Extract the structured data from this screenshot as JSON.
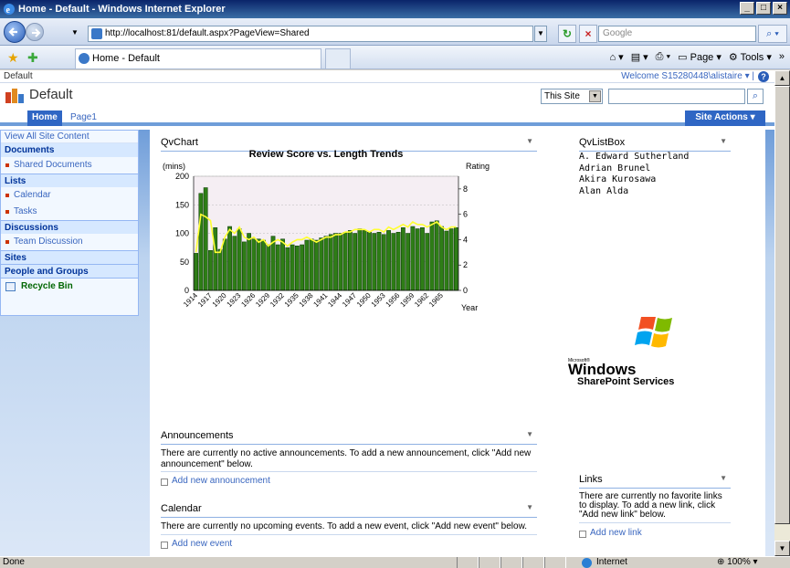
{
  "browser": {
    "title": "Home - Default - Windows Internet Explorer",
    "url": "http://localhost:81/default.aspx?PageView=Shared",
    "search_placeholder": "Google",
    "tab_label": "Home - Default",
    "page_label": "Page",
    "tools_label": "Tools",
    "status_done": "Done",
    "zone": "Internet",
    "zoom": "100%"
  },
  "sharepoint": {
    "breadcrumb": "Default",
    "welcome": "Welcome S15280448\\alistaire ▾ |",
    "site_title": "Default",
    "search_scope": "This Site",
    "tabs": [
      "Home",
      "Page1"
    ],
    "site_actions": "Site Actions ▾"
  },
  "leftnav": {
    "view_all": "View All Site Content",
    "documents": "Documents",
    "shared_documents": "Shared Documents",
    "lists": "Lists",
    "calendar": "Calendar",
    "tasks": "Tasks",
    "discussions": "Discussions",
    "team_discussion": "Team Discussion",
    "sites": "Sites",
    "people_groups": "People and Groups",
    "recycle_bin": "Recycle Bin"
  },
  "webparts": {
    "qvchart_title": "QvChart",
    "qvlistbox_title": "QvListBox",
    "listbox_items": [
      "A. Edward Sutherland",
      "Adrian Brunel",
      "Akira Kurosawa",
      "Alan Alda"
    ],
    "announcements_title": "Announcements",
    "announcements_text": "There are currently no active announcements. To add a new announcement, click \"Add new announcement\" below.",
    "add_announcement": "Add new announcement",
    "calendar_title": "Calendar",
    "calendar_text": "There are currently no upcoming events. To add a new event, click \"Add new event\" below.",
    "add_event": "Add new event",
    "links_title": "Links",
    "links_text": "There are currently no favorite links to display. To add a new link, click \"Add new link\" below.",
    "add_link": "Add new link",
    "wss_small": "Microsoft®",
    "wss_big": "Windows",
    "wss_sub": "SharePoint Services"
  },
  "colors": {
    "bar": "#2e7d16",
    "line": "#ffff33",
    "plot_bg": "#f5eef3"
  },
  "chart_data": {
    "type": "bar",
    "title": "Review Score vs. Length Trends",
    "ylabel": "(mins)",
    "y2label": "Rating",
    "xlabel": "Year",
    "ylim": [
      0,
      200
    ],
    "y2lim": [
      0,
      9
    ],
    "yticks": [
      0,
      50,
      100,
      150,
      200
    ],
    "y2ticks": [
      0,
      2,
      4,
      6,
      8
    ],
    "xticks": [
      "1914",
      "1917",
      "1920",
      "1923",
      "1926",
      "1929",
      "1932",
      "1935",
      "1938",
      "1941",
      "1944",
      "1947",
      "1950",
      "1953",
      "1956",
      "1959",
      "1962",
      "1965"
    ],
    "categories": [
      1914,
      1915,
      1916,
      1917,
      1918,
      1919,
      1920,
      1921,
      1922,
      1923,
      1924,
      1925,
      1926,
      1927,
      1928,
      1929,
      1930,
      1931,
      1932,
      1933,
      1934,
      1935,
      1936,
      1937,
      1938,
      1939,
      1940,
      1941,
      1942,
      1943,
      1944,
      1945,
      1946,
      1947,
      1948,
      1949,
      1950,
      1951,
      1952,
      1953,
      1954,
      1955,
      1956,
      1957,
      1958,
      1959,
      1960,
      1961,
      1962,
      1963,
      1964,
      1965,
      1966,
      1967,
      1968
    ],
    "series": [
      {
        "name": "(mins)",
        "values": [
          65,
          170,
          180,
          70,
          110,
          72,
          90,
          112,
          95,
          108,
          85,
          100,
          90,
          90,
          88,
          80,
          95,
          80,
          90,
          75,
          80,
          78,
          80,
          88,
          90,
          88,
          92,
          95,
          98,
          100,
          100,
          102,
          105,
          100,
          108,
          105,
          102,
          100,
          102,
          98,
          105,
          100,
          102,
          110,
          100,
          112,
          108,
          110,
          100,
          120,
          122,
          112,
          104,
          108,
          110
        ]
      },
      {
        "name": "Rating",
        "values": [
          3.0,
          6.0,
          5.8,
          5.5,
          3.0,
          3.0,
          4.2,
          4.8,
          4.5,
          5.0,
          4.2,
          4.0,
          4.2,
          3.8,
          4.0,
          3.5,
          3.8,
          4.0,
          3.8,
          3.5,
          3.8,
          4.0,
          4.0,
          4.2,
          4.0,
          3.8,
          4.0,
          4.2,
          4.2,
          4.4,
          4.4,
          4.6,
          4.6,
          4.8,
          4.8,
          4.8,
          4.6,
          4.8,
          4.8,
          4.6,
          5.0,
          4.8,
          5.0,
          5.2,
          5.0,
          5.4,
          5.2,
          5.2,
          5.0,
          5.2,
          5.4,
          5.0,
          4.8,
          5.0,
          5.0
        ]
      }
    ]
  }
}
